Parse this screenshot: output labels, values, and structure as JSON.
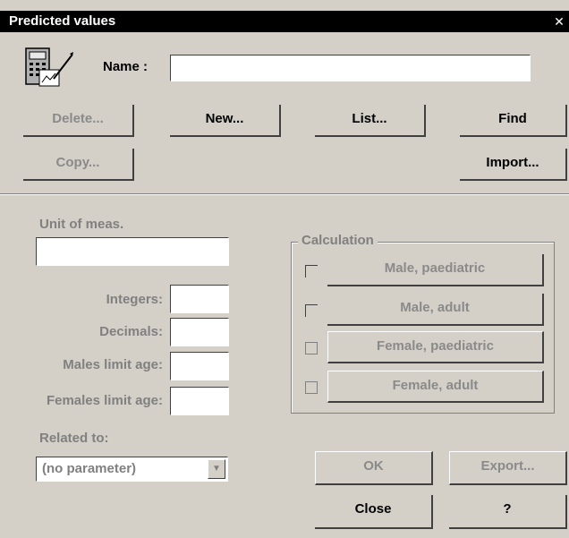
{
  "window": {
    "title": "Predicted values",
    "close_glyph": "✕"
  },
  "name_field": {
    "label": "Name :",
    "value": ""
  },
  "toolbar": {
    "delete": "Delete...",
    "new": "New...",
    "list": "List...",
    "find": "Find",
    "copy": "Copy...",
    "import": "Import..."
  },
  "fields": {
    "unit_label": "Unit of meas.",
    "unit_value": "",
    "integers_label": "Integers:",
    "decimals_label": "Decimals:",
    "males_limit_label": "Males limit age:",
    "females_limit_label": "Females limit age:",
    "related_label": "Related to:",
    "related_value": "(no parameter)"
  },
  "calculation": {
    "title": "Calculation",
    "items": [
      {
        "label": "Male, paediatric"
      },
      {
        "label": "Male, adult"
      },
      {
        "label": "Female, paediatric"
      },
      {
        "label": "Female, adult"
      }
    ]
  },
  "actions": {
    "ok": "OK",
    "export": "Export...",
    "close": "Close",
    "help": "?"
  },
  "icons": {
    "app": "calculator-icon",
    "dropdown": "chevron-down-icon"
  }
}
